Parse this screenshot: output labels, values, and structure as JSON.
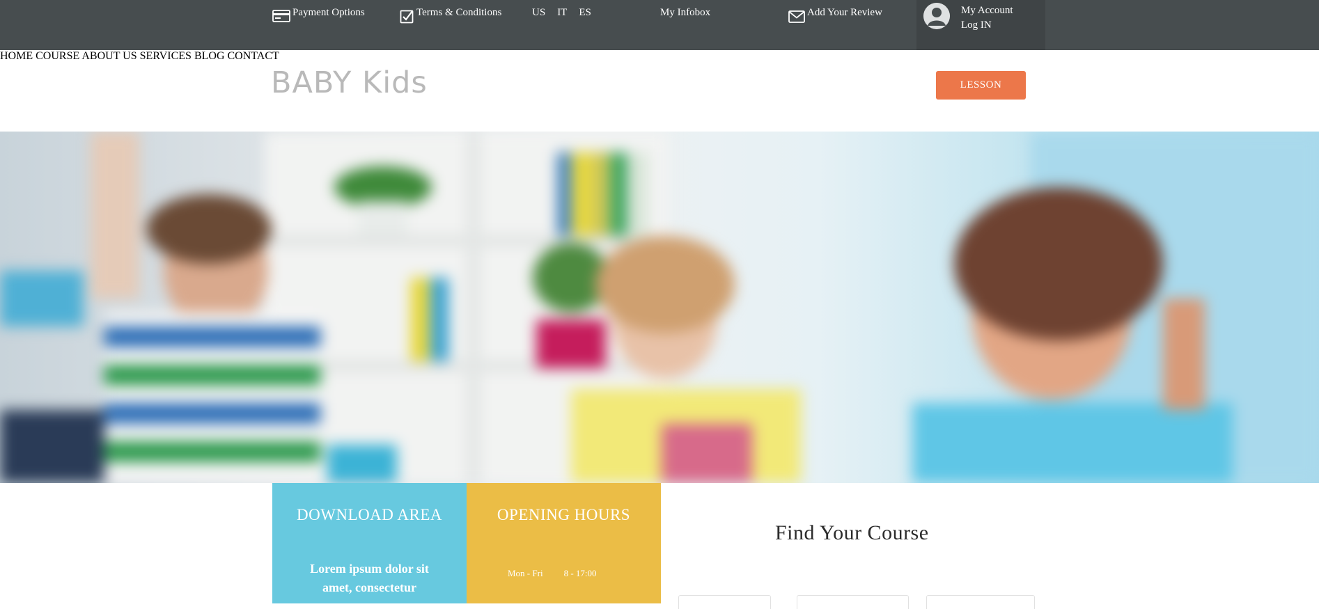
{
  "topbar": {
    "payment_label": "Payment Options",
    "terms_label": "Terms & Conditions",
    "languages": [
      "US",
      "IT",
      "ES"
    ],
    "infobox_label": "My Infobox",
    "review_label": "Add Your Review",
    "account_label": "My Account",
    "login_label": "Log IN",
    "icons": {
      "payment": "credit-card-icon",
      "terms": "checkbox-icon",
      "review": "envelope-icon",
      "account": "user-icon"
    }
  },
  "header": {
    "logo": "BABY Kids",
    "nav": [
      "HOME",
      "COURSE",
      "ABOUT US",
      "SERVICES",
      "BLOG",
      "CONTACT"
    ],
    "lesson_button": "LESSON"
  },
  "download": {
    "title": "DOWNLOAD AREA",
    "text": "Lorem ipsum dolor sit amet, consectetur"
  },
  "hours": {
    "title": "OPENING HOURS",
    "days": "Mon - Fri",
    "time": "8 - 17:00"
  },
  "find": {
    "title": "Find Your Course"
  },
  "colors": {
    "topbar": "#474d4f",
    "accent": "#ec774a",
    "download_bg": "#67c9df",
    "hours_bg": "#ebbd46",
    "nav_text": "#a9a9a9"
  }
}
